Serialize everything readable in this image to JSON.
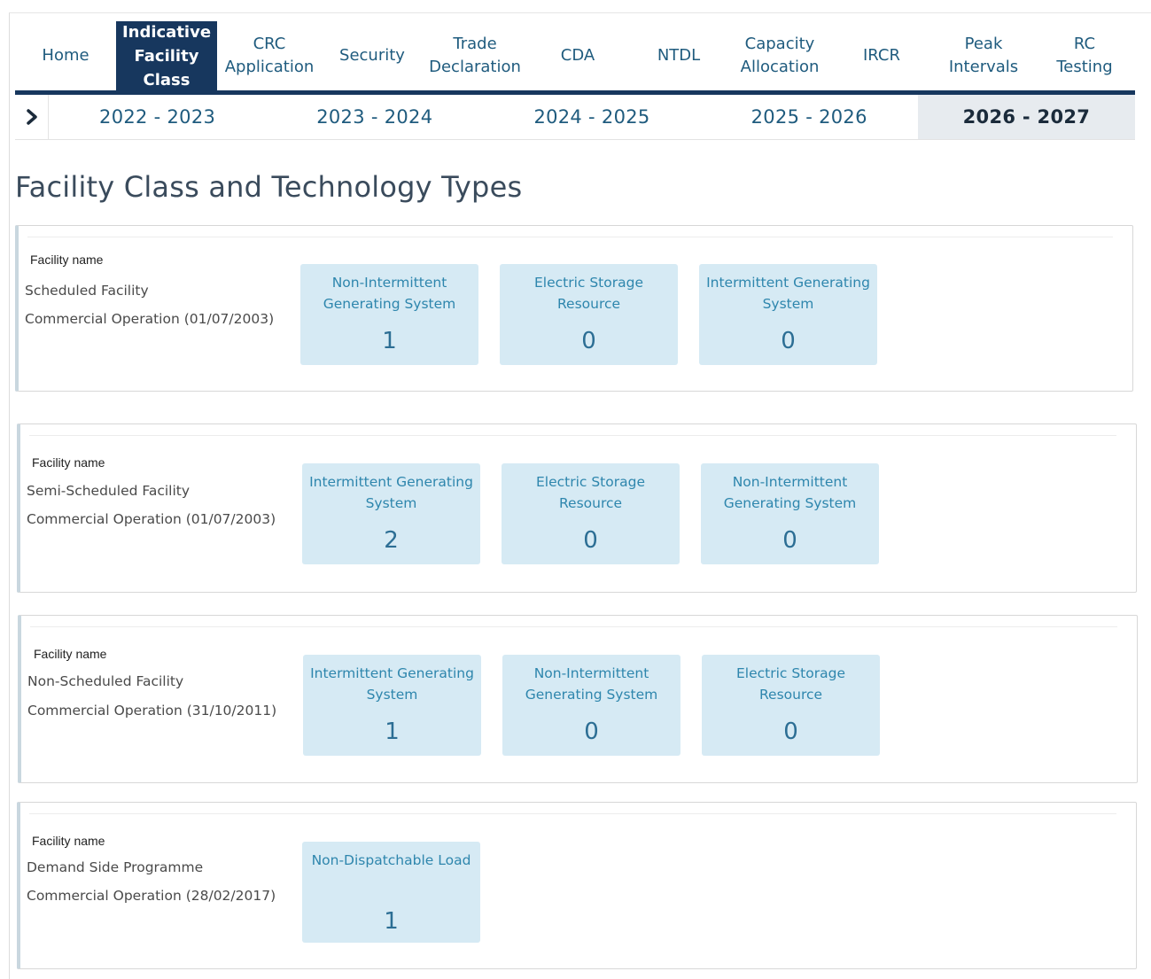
{
  "nav": {
    "items": [
      {
        "lines": [
          "Home"
        ],
        "active": false
      },
      {
        "lines": [
          "Indicative",
          "Facility",
          "Class"
        ],
        "active": true
      },
      {
        "lines": [
          "CRC",
          "Application"
        ],
        "active": false
      },
      {
        "lines": [
          "Security"
        ],
        "active": false
      },
      {
        "lines": [
          "Trade",
          "Declaration"
        ],
        "active": false
      },
      {
        "lines": [
          "CDA"
        ],
        "active": false
      },
      {
        "lines": [
          "NTDL"
        ],
        "active": false
      },
      {
        "lines": [
          "Capacity",
          "Allocation"
        ],
        "active": false
      },
      {
        "lines": [
          "IRCR"
        ],
        "active": false
      },
      {
        "lines": [
          "Peak",
          "Intervals"
        ],
        "active": false
      },
      {
        "lines": [
          "RC",
          "Testing"
        ],
        "active": false
      }
    ]
  },
  "years": {
    "chevron_icon": "chevron-right-icon",
    "items": [
      "2022 - 2023",
      "2023 - 2024",
      "2024 - 2025",
      "2025 - 2026",
      "2026 - 2027"
    ],
    "selected": "2026 - 2027"
  },
  "page_title": "Facility Class and Technology Types",
  "facilities": [
    {
      "label": "Facility name",
      "name": "Scheduled Facility",
      "operation": "Commercial Operation (01/07/2003)",
      "tiles": [
        {
          "name": "Non-Intermittent Generating System",
          "count": "1"
        },
        {
          "name": "Electric Storage Resource",
          "count": "0"
        },
        {
          "name": "Intermittent Generating System",
          "count": "0"
        }
      ]
    },
    {
      "label": "Facility name",
      "name": "Semi-Scheduled Facility",
      "operation": "Commercial Operation (01/07/2003)",
      "tiles": [
        {
          "name": "Intermittent Generating System",
          "count": "2"
        },
        {
          "name": "Electric Storage Resource",
          "count": "0"
        },
        {
          "name": "Non-Intermittent Generating System",
          "count": "0"
        }
      ]
    },
    {
      "label": "Facility name",
      "name": "Non-Scheduled Facility",
      "operation": "Commercial Operation (31/10/2011)",
      "tiles": [
        {
          "name": "Intermittent Generating System",
          "count": "1"
        },
        {
          "name": "Non-Intermittent Generating System",
          "count": "0"
        },
        {
          "name": "Electric Storage Resource",
          "count": "0"
        }
      ]
    },
    {
      "label": "Facility name",
      "name": "Demand Side Programme",
      "operation": "Commercial Operation (28/02/2017)",
      "tiles": [
        {
          "name": "Non-Dispatchable Load",
          "count": "1"
        }
      ]
    }
  ],
  "colors": {
    "nav_active_bg": "#17375e",
    "link": "#1f5b7e",
    "tile_bg": "#d6eaf4",
    "tile_text": "#2e86ad"
  }
}
